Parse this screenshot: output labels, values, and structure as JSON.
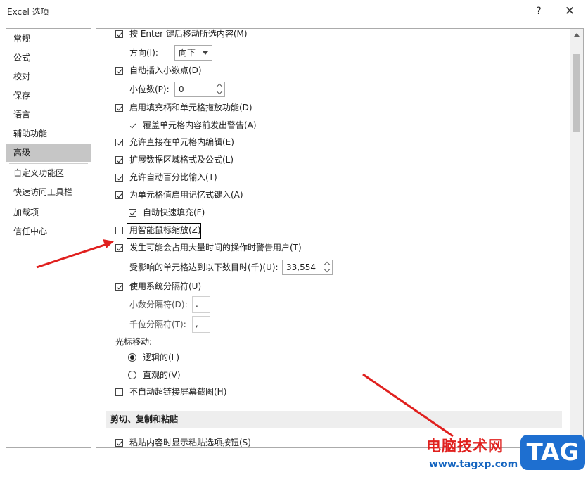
{
  "window": {
    "title": "Excel 选项",
    "help": "?",
    "close": "✕"
  },
  "sidebar": {
    "items": [
      {
        "label": "常规"
      },
      {
        "label": "公式"
      },
      {
        "label": "校对"
      },
      {
        "label": "保存"
      },
      {
        "label": "语言"
      },
      {
        "label": "辅助功能"
      },
      {
        "label": "高级",
        "selected": true
      },
      {
        "label": "自定义功能区"
      },
      {
        "label": "快速访问工具栏"
      },
      {
        "label": "加载项"
      },
      {
        "label": "信任中心"
      }
    ]
  },
  "options": {
    "enter_move": {
      "label": "按 Enter 键后移动所选内容(M)",
      "checked": true
    },
    "direction": {
      "label": "方向(I):",
      "value": "向下"
    },
    "auto_decimal": {
      "label": "自动插入小数点(D)",
      "checked": true
    },
    "places": {
      "label": "小位数(P):",
      "value": "0"
    },
    "fill_handle": {
      "label": "启用填充柄和单元格拖放功能(D)",
      "checked": true
    },
    "overwrite_alert": {
      "label": "覆盖单元格内容前发出警告(A)",
      "checked": true
    },
    "edit_in_cell": {
      "label": "允许直接在单元格内编辑(E)",
      "checked": true
    },
    "extend_formats": {
      "label": "扩展数据区域格式及公式(L)",
      "checked": true
    },
    "auto_percent": {
      "label": "允许自动百分比输入(T)",
      "checked": true
    },
    "autocomplete": {
      "label": "为单元格值启用记忆式键入(A)",
      "checked": true
    },
    "flash_fill": {
      "label": "自动快速填充(F)",
      "checked": true
    },
    "intellimouse_zoom": {
      "label": "用智能鼠标缩放(Z)",
      "checked": false
    },
    "alert_slow": {
      "label": "发生可能会占用大量时间的操作时警告用户(T)",
      "checked": true
    },
    "cells_affected": {
      "label": "受影响的单元格达到以下数目时(千)(U):",
      "value": "33,554"
    },
    "system_separators": {
      "label": "使用系统分隔符(U)",
      "checked": true
    },
    "decimal_separator": {
      "label": "小数分隔符(D):",
      "value": "."
    },
    "thousands_separator": {
      "label": "千位分隔符(T):",
      "value": ","
    },
    "cursor_movement": {
      "label": "光标移动:"
    },
    "logical": {
      "label": "逻辑的(L)",
      "selected": true
    },
    "visual": {
      "label": "直观的(V)",
      "selected": false
    },
    "no_hyperlink_screenshot": {
      "label": "不自动超链接屏幕截图(H)",
      "checked": false
    }
  },
  "sections": {
    "cut_copy_paste": {
      "title": "剪切、复制和粘贴"
    }
  },
  "paste_options": {
    "label": "粘贴内容时显示粘贴选项按钮(S)",
    "checked": true
  },
  "watermark": {
    "site_name": "电脑技术网",
    "url": "www.tagxp.com",
    "logo": "TAG"
  },
  "colors": {
    "arrow": "#e0201e",
    "selected_nav": "#c6c6c6",
    "watermark_red": "#e0201e",
    "watermark_blue": "#1e6fd0"
  }
}
